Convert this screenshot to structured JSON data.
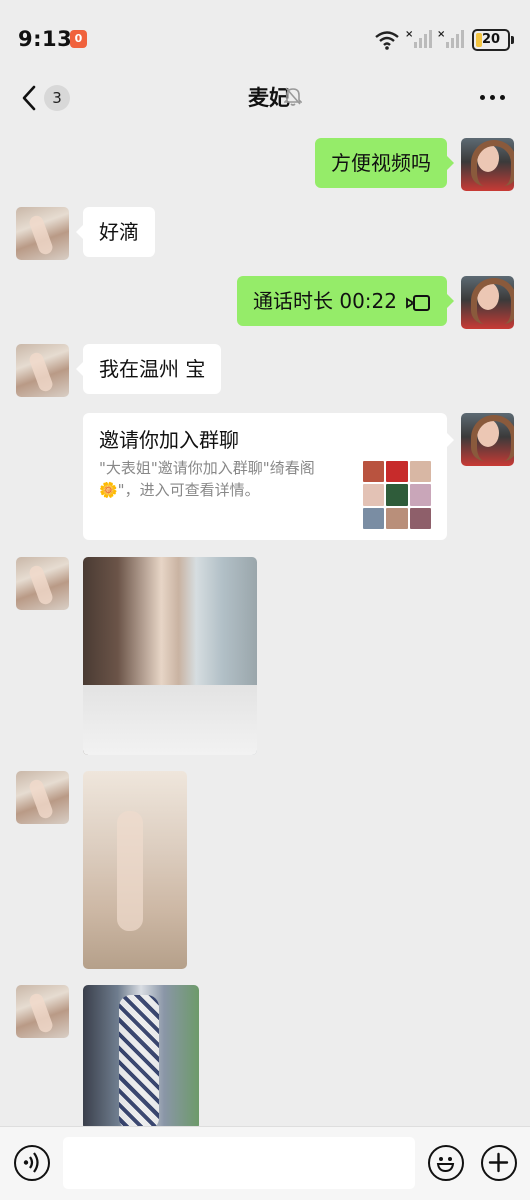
{
  "status_bar": {
    "time": "9:13",
    "notification_count": "0",
    "battery_level": "20",
    "battery_fraction": 0.2,
    "icons": [
      "wifi-icon",
      "signal-icon",
      "signal-icon",
      "battery-icon"
    ]
  },
  "header": {
    "back_icon": "chevron-left-icon",
    "unread_count": "3",
    "title": "麦妃",
    "mute_icon": "bell-off-icon",
    "more_icon": "more-dots-icon"
  },
  "messages": [
    {
      "sender": "me",
      "type": "text",
      "text": "方便视频吗"
    },
    {
      "sender": "her",
      "type": "text",
      "text": "好滴"
    },
    {
      "sender": "me",
      "type": "call",
      "text": "通话时长 00:22",
      "icon": "video-call-icon"
    },
    {
      "sender": "her",
      "type": "text",
      "text": "我在温州 宝"
    },
    {
      "sender": "me",
      "type": "group-invite",
      "title": "邀请你加入群聊",
      "description": "\"大表姐\"邀请你加入群聊\"绮春阁🌼\"，进入可查看详情。"
    },
    {
      "sender": "her",
      "type": "image"
    },
    {
      "sender": "her",
      "type": "image"
    },
    {
      "sender": "her",
      "type": "image"
    }
  ],
  "input_bar": {
    "voice_icon": "voice-icon",
    "input_value": "",
    "emoji_icon": "emoji-icon",
    "plus_icon": "plus-icon"
  },
  "colors": {
    "background": "#ededed",
    "outgoing_bubble": "#95ec69",
    "incoming_bubble": "#ffffff",
    "battery_fill": "#f4c542",
    "badge": "#f0623d"
  }
}
